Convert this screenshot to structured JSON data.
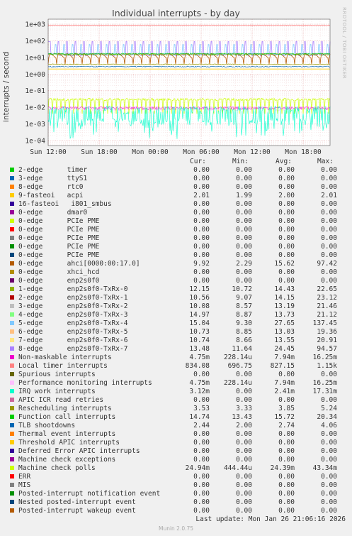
{
  "title": "Individual interrupts - by day",
  "vertical_label": "interrupts / second",
  "watermark": "RRDTOOL / TOBI OETIKER",
  "columns": {
    "cur": "Cur:",
    "min": "Min:",
    "avg": "Avg:",
    "max": "Max:"
  },
  "last_update": "Last update: Mon Jan 26 21:06:16 2026",
  "version": "Munin 2.0.75",
  "chart_data": {
    "type": "line",
    "yscale": "log",
    "ylim": [
      5e-05,
      2000
    ],
    "y_ticks": [
      "1e+03",
      "1e+02",
      "1e+01",
      "1e+00",
      "1e-01",
      "1e-02",
      "1e-03",
      "1e-04"
    ],
    "x_ticks": [
      "Sun 12:00",
      "Sun 18:00",
      "Mon 00:00",
      "Mon 06:00",
      "Mon 12:00",
      "Mon 18:00"
    ],
    "grid": true
  },
  "legend": [
    {
      "name": "2-edge      timer",
      "color": "#00cc00",
      "cur": "0.00",
      "min": "0.00",
      "avg": "0.00",
      "max": "0.00"
    },
    {
      "name": "3-edge      ttyS1",
      "color": "#0066b3",
      "cur": "0.00",
      "min": "0.00",
      "avg": "0.00",
      "max": "0.00"
    },
    {
      "name": "8-edge      rtc0",
      "color": "#ff8000",
      "cur": "0.00",
      "min": "0.00",
      "avg": "0.00",
      "max": "0.00"
    },
    {
      "name": "9-fasteoi   acpi",
      "color": "#ffcc00",
      "cur": "2.01",
      "min": "1.99",
      "avg": "2.00",
      "max": "2.01"
    },
    {
      "name": "16-fasteoi   i801_smbus",
      "color": "#330099",
      "cur": "0.00",
      "min": "0.00",
      "avg": "0.00",
      "max": "0.00"
    },
    {
      "name": "0-edge      dmar0",
      "color": "#990099",
      "cur": "0.00",
      "min": "0.00",
      "avg": "0.00",
      "max": "0.00"
    },
    {
      "name": "0-edge      PCIe PME",
      "color": "#ccff00",
      "cur": "0.00",
      "min": "0.00",
      "avg": "0.00",
      "max": "0.00"
    },
    {
      "name": "0-edge      PCIe PME",
      "color": "#ff0000",
      "cur": "0.00",
      "min": "0.00",
      "avg": "0.00",
      "max": "0.00"
    },
    {
      "name": "0-edge      PCIe PME",
      "color": "#808080",
      "cur": "0.00",
      "min": "0.00",
      "avg": "0.00",
      "max": "0.00"
    },
    {
      "name": "0-edge      PCIe PME",
      "color": "#008f00",
      "cur": "0.00",
      "min": "0.00",
      "avg": "0.00",
      "max": "0.00"
    },
    {
      "name": "0-edge      PCIe PME",
      "color": "#00487d",
      "cur": "0.00",
      "min": "0.00",
      "avg": "0.00",
      "max": "0.00"
    },
    {
      "name": "0-edge      ahci[0000:00:17.0]",
      "color": "#b35a00",
      "cur": "9.92",
      "min": "2.29",
      "avg": "15.62",
      "max": "97.42"
    },
    {
      "name": "0-edge      xhci_hcd",
      "color": "#b38f00",
      "cur": "0.00",
      "min": "0.00",
      "avg": "0.00",
      "max": "0.00"
    },
    {
      "name": "0-edge      enp2s0f0",
      "color": "#6b006b",
      "cur": "0.00",
      "min": "0.00",
      "avg": "0.00",
      "max": "0.00"
    },
    {
      "name": "1-edge      enp2s0f0-TxRx-0",
      "color": "#8fb300",
      "cur": "12.15",
      "min": "10.72",
      "avg": "14.43",
      "max": "22.65"
    },
    {
      "name": "2-edge      enp2s0f0-TxRx-1",
      "color": "#b30000",
      "cur": "10.56",
      "min": "9.07",
      "avg": "14.15",
      "max": "23.12"
    },
    {
      "name": "3-edge      enp2s0f0-TxRx-2",
      "color": "#bebebe",
      "cur": "10.08",
      "min": "8.57",
      "avg": "13.19",
      "max": "21.46"
    },
    {
      "name": "4-edge      enp2s0f0-TxRx-3",
      "color": "#80ff80",
      "cur": "14.97",
      "min": "8.87",
      "avg": "13.73",
      "max": "21.12"
    },
    {
      "name": "5-edge      enp2s0f0-TxRx-4",
      "color": "#80c9ff",
      "cur": "15.04",
      "min": "9.30",
      "avg": "27.65",
      "max": "137.45"
    },
    {
      "name": "6-edge      enp2s0f0-TxRx-5",
      "color": "#ffc080",
      "cur": "10.73",
      "min": "8.85",
      "avg": "13.03",
      "max": "19.36"
    },
    {
      "name": "7-edge      enp2s0f0-TxRx-6",
      "color": "#ffe680",
      "cur": "10.74",
      "min": "8.66",
      "avg": "13.55",
      "max": "20.91"
    },
    {
      "name": "8-edge      enp2s0f0-TxRx-7",
      "color": "#aa80ff",
      "cur": "13.48",
      "min": "11.64",
      "avg": "24.45",
      "max": "94.57"
    },
    {
      "name": "Non-maskable interrupts",
      "color": "#ee00cc",
      "cur": "4.75m",
      "min": "228.14u",
      "avg": "7.94m",
      "max": "16.25m"
    },
    {
      "name": "Local timer interrupts",
      "color": "#ff8080",
      "cur": "834.08",
      "min": "696.75",
      "avg": "827.15",
      "max": "1.15k"
    },
    {
      "name": "Spurious interrupts",
      "color": "#666600",
      "cur": "0.00",
      "min": "0.00",
      "avg": "0.00",
      "max": "0.00"
    },
    {
      "name": "Performance monitoring interrupts",
      "color": "#ffbfff",
      "cur": "4.75m",
      "min": "228.14u",
      "avg": "7.94m",
      "max": "16.25m"
    },
    {
      "name": "IRQ work interrupts",
      "color": "#00ffcc",
      "cur": "3.12m",
      "min": "0.00",
      "avg": "2.41m",
      "max": "17.31m"
    },
    {
      "name": "APIC ICR read retries",
      "color": "#cc6699",
      "cur": "0.00",
      "min": "0.00",
      "avg": "0.00",
      "max": "0.00"
    },
    {
      "name": "Rescheduling interrupts",
      "color": "#999900",
      "cur": "3.53",
      "min": "3.33",
      "avg": "3.85",
      "max": "5.24"
    },
    {
      "name": "Function call interrupts",
      "color": "#00cc00",
      "cur": "14.74",
      "min": "13.43",
      "avg": "15.72",
      "max": "20.34"
    },
    {
      "name": "TLB shootdowns",
      "color": "#0066b3",
      "cur": "2.44",
      "min": "2.00",
      "avg": "2.74",
      "max": "4.06"
    },
    {
      "name": "Thermal event interrupts",
      "color": "#ff8000",
      "cur": "0.00",
      "min": "0.00",
      "avg": "0.00",
      "max": "0.00"
    },
    {
      "name": "Threshold APIC interrupts",
      "color": "#ffcc00",
      "cur": "0.00",
      "min": "0.00",
      "avg": "0.00",
      "max": "0.00"
    },
    {
      "name": "Deferred Error APIC interrupts",
      "color": "#330099",
      "cur": "0.00",
      "min": "0.00",
      "avg": "0.00",
      "max": "0.00"
    },
    {
      "name": "Machine check exceptions",
      "color": "#990099",
      "cur": "0.00",
      "min": "0.00",
      "avg": "0.00",
      "max": "0.00"
    },
    {
      "name": "Machine check polls",
      "color": "#ccff00",
      "cur": "24.94m",
      "min": "444.44u",
      "avg": "24.39m",
      "max": "43.34m"
    },
    {
      "name": "ERR",
      "color": "#ff0000",
      "cur": "0.00",
      "min": "0.00",
      "avg": "0.00",
      "max": "0.00"
    },
    {
      "name": "MIS",
      "color": "#808080",
      "cur": "0.00",
      "min": "0.00",
      "avg": "0.00",
      "max": "0.00"
    },
    {
      "name": "Posted-interrupt notification event",
      "color": "#008f00",
      "cur": "0.00",
      "min": "0.00",
      "avg": "0.00",
      "max": "0.00"
    },
    {
      "name": "Nested posted-interrupt event",
      "color": "#00487d",
      "cur": "0.00",
      "min": "0.00",
      "avg": "0.00",
      "max": "0.00"
    },
    {
      "name": "Posted-interrupt wakeup event",
      "color": "#b35a00",
      "cur": "0.00",
      "min": "0.00",
      "avg": "0.00",
      "max": "0.00"
    }
  ]
}
